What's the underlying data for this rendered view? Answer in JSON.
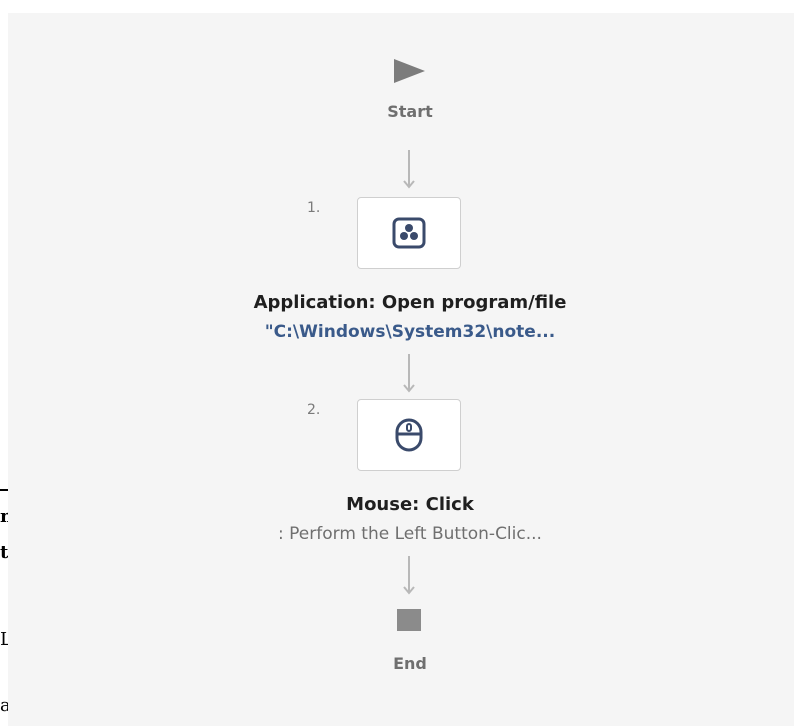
{
  "flow": {
    "start_label": "Start",
    "end_label": "End",
    "steps": [
      {
        "number": "1.",
        "icon": "application-icon",
        "title": "Application: Open program/file",
        "subtitle": "\"C:\\Windows\\System32\\note..."
      },
      {
        "number": "2.",
        "icon": "mouse-icon",
        "title": "Mouse: Click",
        "subtitle": ": Perform the Left Button-Clic..."
      }
    ]
  },
  "background_doc": {
    "fragments": [
      "na",
      "ta",
      "Lo",
      "ar"
    ]
  },
  "colors": {
    "canvas": "#f5f5f5",
    "icon_border": "#3a4a6b",
    "link_text": "#3a5a8a",
    "muted": "#6f6f6f"
  }
}
